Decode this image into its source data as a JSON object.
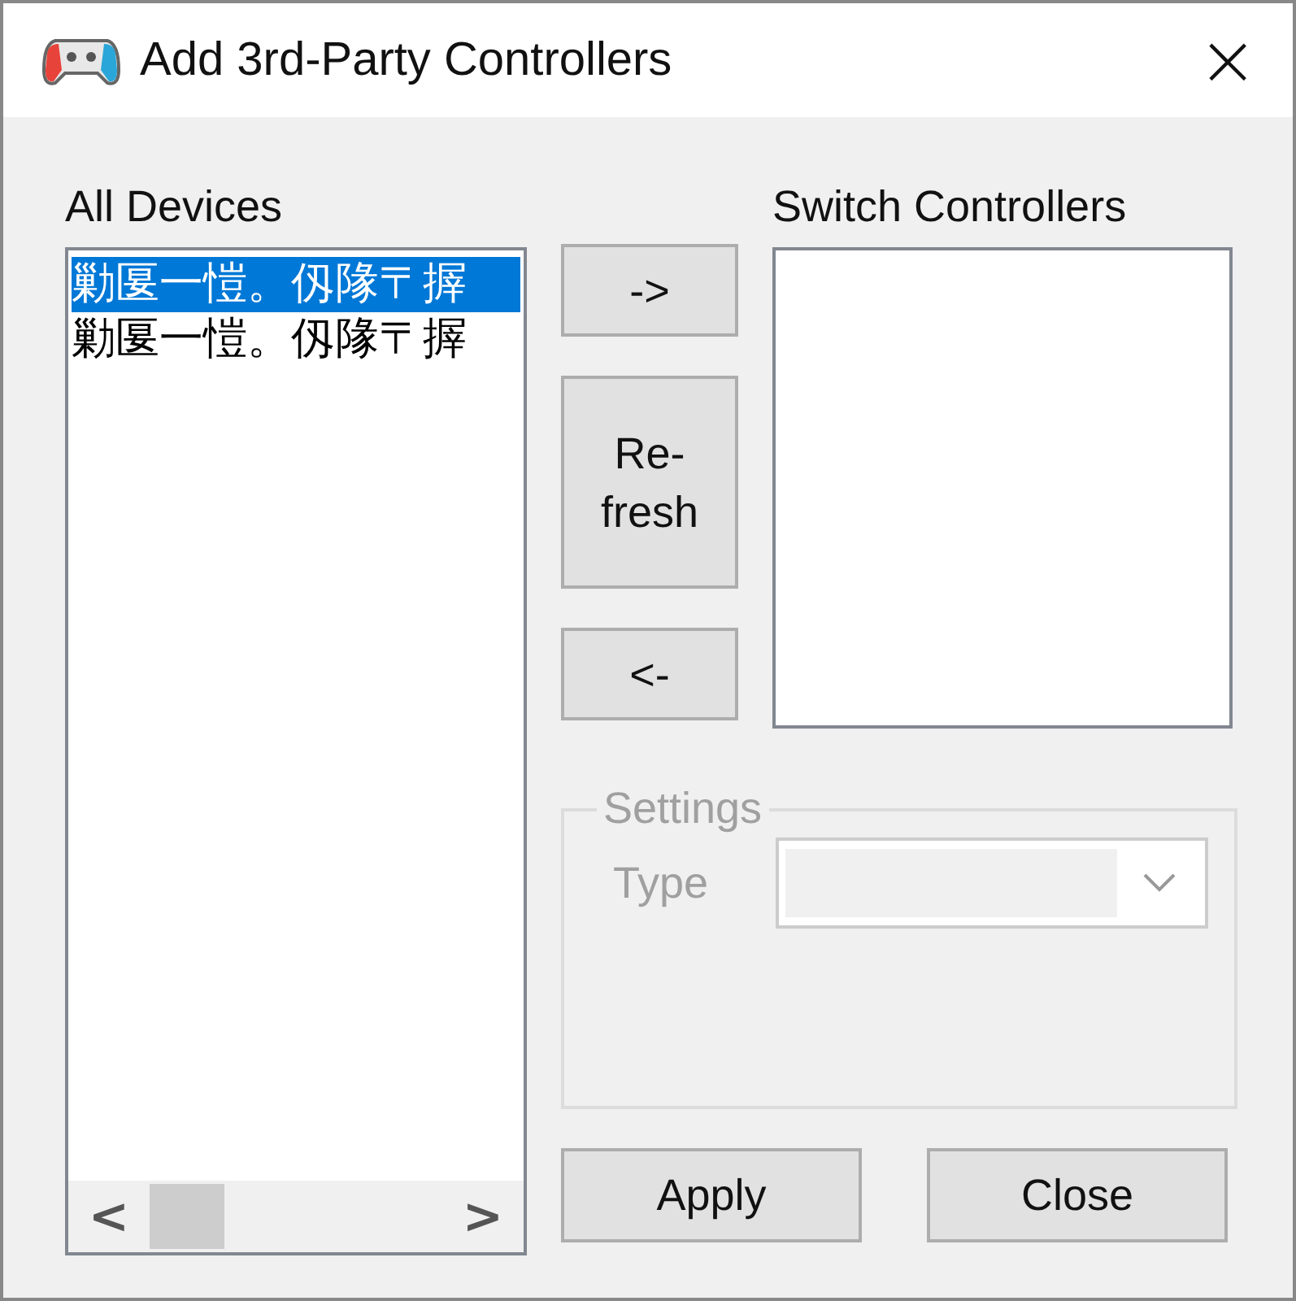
{
  "window": {
    "title": "Add 3rd-Party Controllers",
    "close": "×"
  },
  "all_devices": {
    "label": "All Devices",
    "items": [
      {
        "text": "勦匽一愷。仭䧘〒搱",
        "selected": true
      },
      {
        "text": "勦匽一愷。仭䧘〒搱",
        "selected": false
      }
    ],
    "scroll_left": "<",
    "scroll_right": ">"
  },
  "move_buttons": [
    {
      "label": "->"
    },
    {
      "label": "Re-\nfresh"
    },
    {
      "label": "<-"
    }
  ],
  "switch_controllers": {
    "label": "Switch Controllers"
  },
  "settings": {
    "title": "Settings",
    "disabled": true,
    "type_label": "Type"
  },
  "buttons": [
    {
      "label": "Apply"
    },
    {
      "label": "Close"
    }
  ]
}
